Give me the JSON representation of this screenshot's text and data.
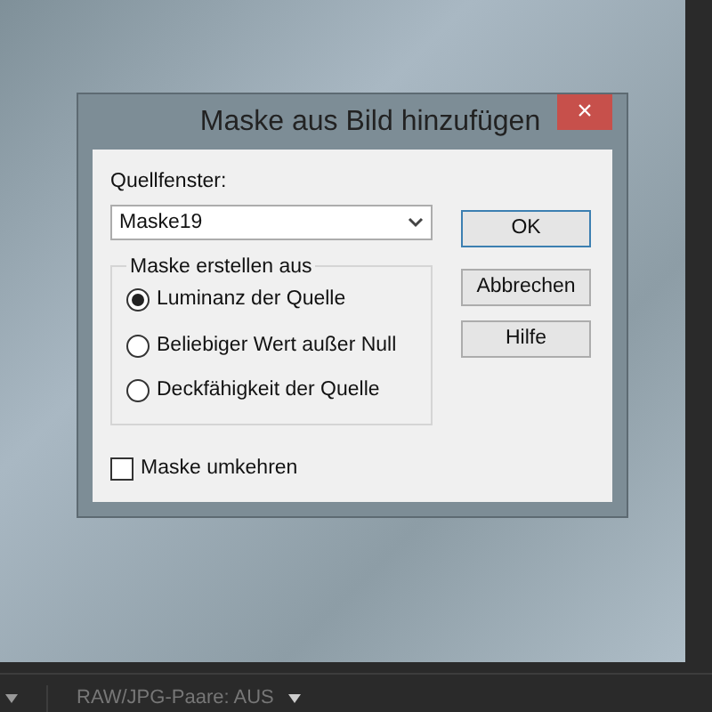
{
  "dialog": {
    "title": "Maske aus Bild hinzufügen",
    "close": "×",
    "source_label": "Quellfenster:",
    "source_value": "Maske19",
    "group_label": "Maske erstellen aus",
    "options": [
      {
        "label": "Luminanz der Quelle",
        "selected": true
      },
      {
        "label": "Beliebiger Wert außer Null",
        "selected": false
      },
      {
        "label": "Deckfähigkeit der Quelle",
        "selected": false
      }
    ],
    "invert": {
      "label": "Maske umkehren",
      "checked": false
    },
    "buttons": [
      {
        "label": "OK",
        "default": true
      },
      {
        "label": "Abbrechen",
        "default": false
      },
      {
        "label": "Hilfe",
        "default": false
      }
    ]
  },
  "status_bar": {
    "filter": "RAW/JPG-Paare: AUS"
  }
}
